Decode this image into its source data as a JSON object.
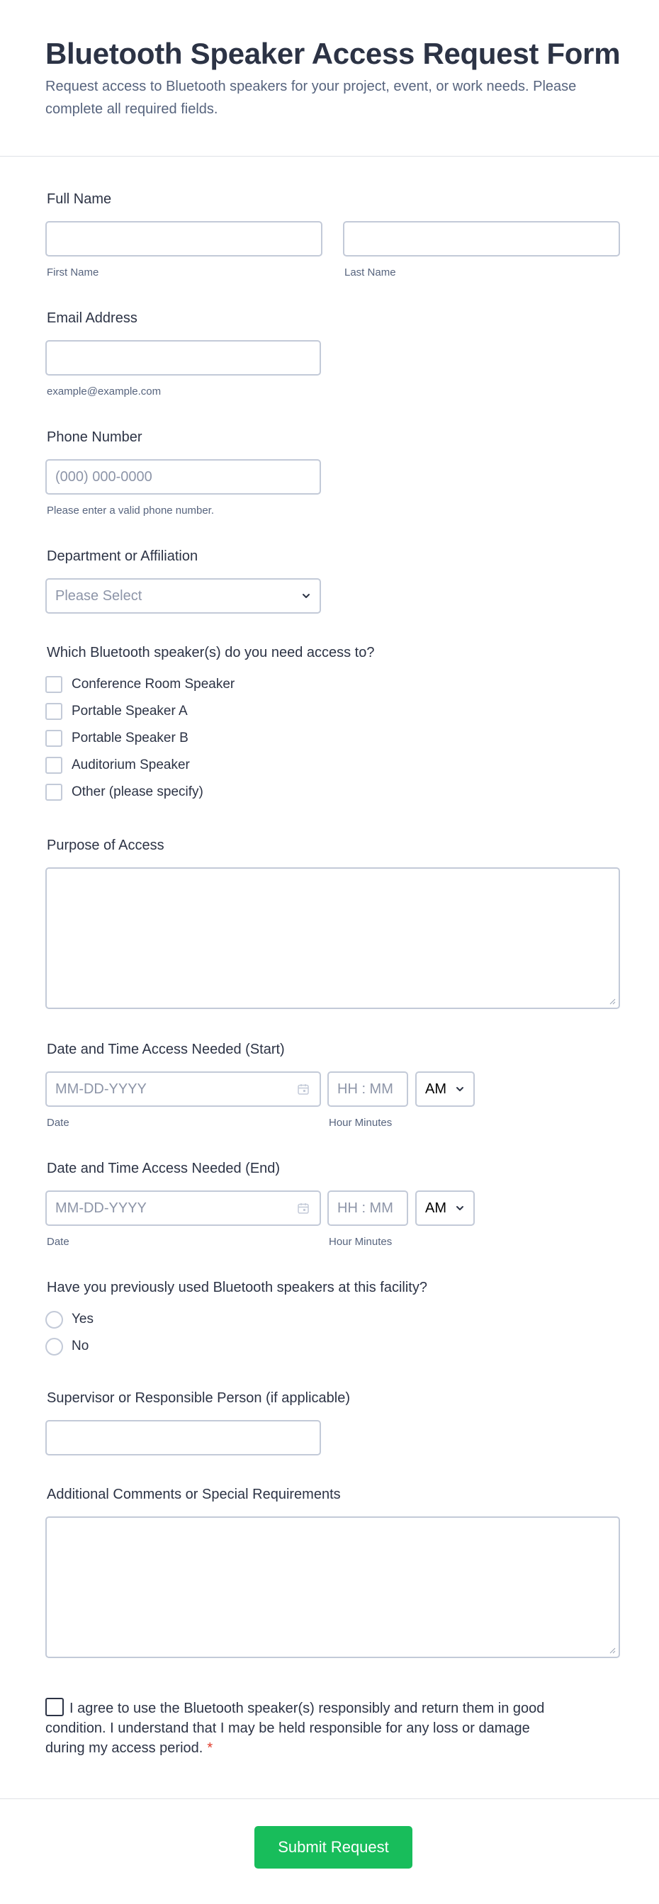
{
  "header": {
    "title": "Bluetooth Speaker Access Request Form",
    "subtitle": "Request access to Bluetooth speakers for your project, event, or work needs. Please complete all required fields."
  },
  "full_name": {
    "label": "Full Name",
    "first_sublabel": "First Name",
    "last_sublabel": "Last Name",
    "first_value": "",
    "last_value": ""
  },
  "email": {
    "label": "Email Address",
    "value": "",
    "sublabel": "example@example.com"
  },
  "phone": {
    "label": "Phone Number",
    "placeholder": "(000) 000-0000",
    "sublabel": "Please enter a valid phone number."
  },
  "department": {
    "label": "Department or Affiliation",
    "selected": "Please Select"
  },
  "speakers": {
    "label": "Which Bluetooth speaker(s) do you need access to?",
    "options": [
      "Conference Room Speaker",
      "Portable Speaker A",
      "Portable Speaker B",
      "Auditorium Speaker",
      "Other (please specify)"
    ]
  },
  "purpose": {
    "label": "Purpose of Access",
    "value": ""
  },
  "start": {
    "label": "Date and Time Access Needed (Start)",
    "date_placeholder": "MM-DD-YYYY",
    "time_placeholder": "HH : MM",
    "ampm": "AM",
    "date_sublabel": "Date",
    "time_sublabel": "Hour Minutes"
  },
  "end": {
    "label": "Date and Time Access Needed (End)",
    "date_placeholder": "MM-DD-YYYY",
    "time_placeholder": "HH : MM",
    "ampm": "AM",
    "date_sublabel": "Date",
    "time_sublabel": "Hour Minutes"
  },
  "previous_use": {
    "label": "Have you previously used Bluetooth speakers at this facility?",
    "options": [
      "Yes",
      "No"
    ]
  },
  "supervisor": {
    "label": "Supervisor or Responsible Person (if applicable)",
    "value": ""
  },
  "comments": {
    "label": "Additional Comments or Special Requirements",
    "value": ""
  },
  "agreement": {
    "text": "I agree to use the Bluetooth speaker(s) responsibly and return them in good condition. I understand that I may be held responsible for any loss or damage during my access period.",
    "required_mark": "*"
  },
  "submit": {
    "label": "Submit Request",
    "color": "#18bd5b"
  },
  "icons": {
    "calendar": "calendar-icon",
    "chevron": "chevron-down-icon"
  }
}
